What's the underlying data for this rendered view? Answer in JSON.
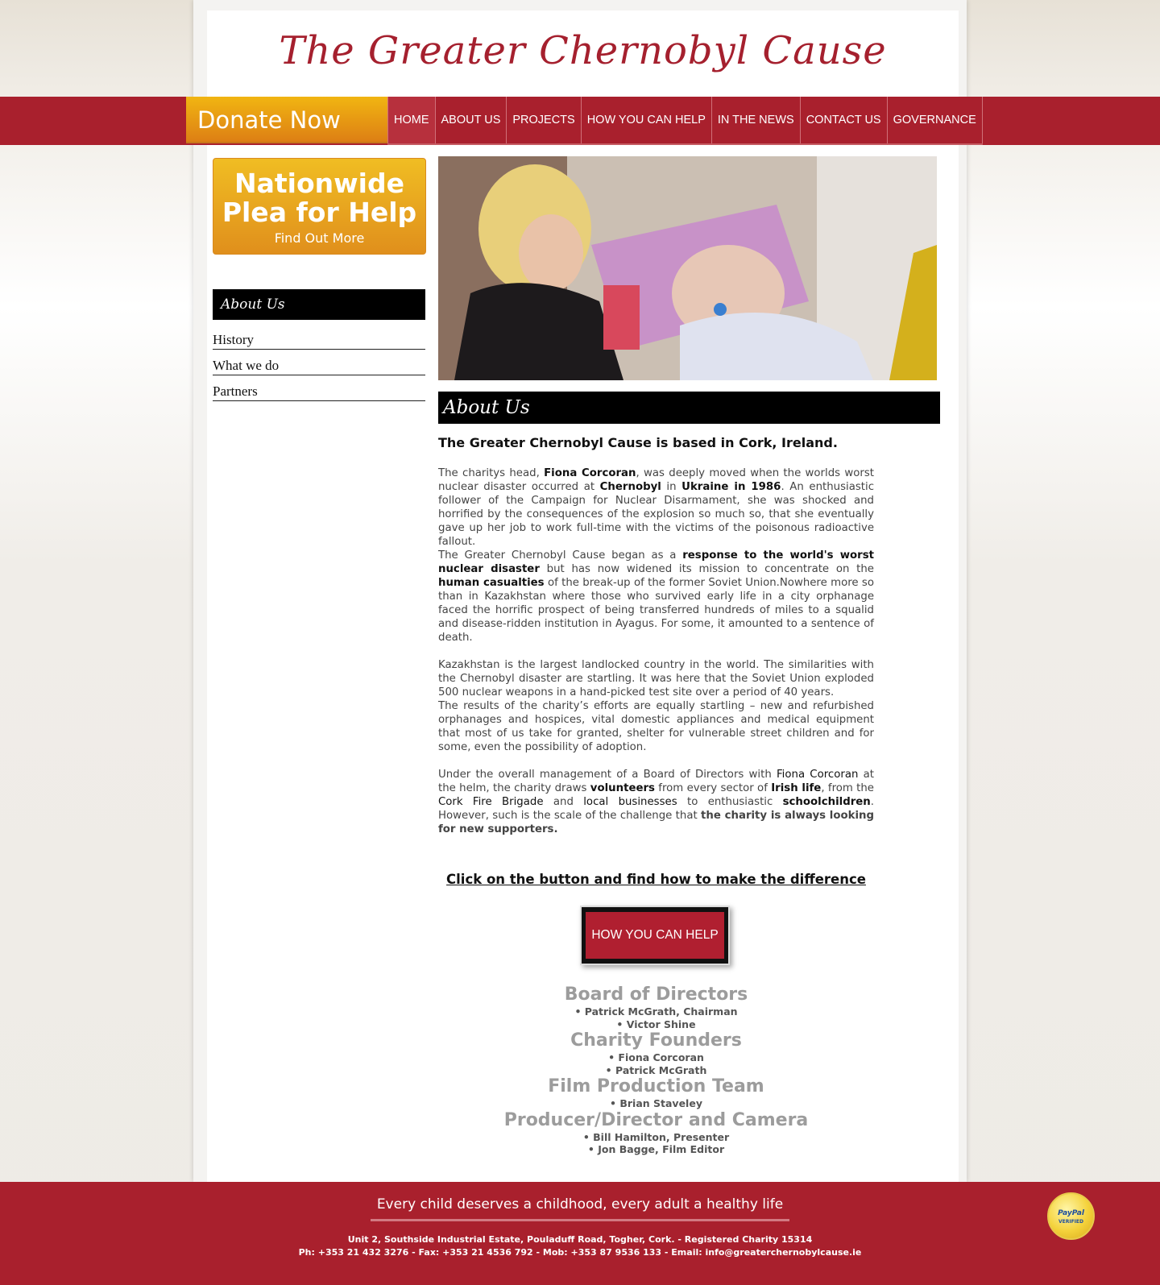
{
  "site": {
    "title": "The Greater Chernobyl Cause"
  },
  "donate": {
    "label": "Donate Now"
  },
  "nav": [
    {
      "label": "HOME"
    },
    {
      "label": "ABOUT US"
    },
    {
      "label": "PROJECTS"
    },
    {
      "label": "HOW YOU CAN HELP"
    },
    {
      "label": "IN THE NEWS"
    },
    {
      "label": "CONTACT US"
    },
    {
      "label": "GOVERNANCE"
    }
  ],
  "plea": {
    "title_line1": "Nationwide",
    "title_line2": "Plea for Help",
    "link": "Find Out More"
  },
  "sidebar": {
    "heading": "About Us",
    "items": [
      {
        "label": "History"
      },
      {
        "label": "What we do"
      },
      {
        "label": "Partners"
      }
    ]
  },
  "main": {
    "heading": "About Us",
    "lead": "The Greater Chernobyl Cause is based in Cork, Ireland.",
    "p1": {
      "t1": "The charitys head, ",
      "b1": "Fiona Corcoran",
      "t2": ", was deeply moved when the worlds worst nuclear disaster occurred at ",
      "b2": "Chernobyl",
      "t3": " in ",
      "b3": "Ukraine in 1986",
      "t4": ". An enthusiastic follower of the Campaign for Nuclear Disarmament, she was shocked and horrified by the consequences of the explosion so much so, that she eventually gave up her job to work full-time with the victims of the poisonous radioactive fallout."
    },
    "p2": {
      "t1": "The Greater Chernobyl Cause began as a ",
      "b1": "response to the world's worst nuclear disaster",
      "t2": " but has now widened its mission to concentrate on the ",
      "b2": "human casualties",
      "t3": " of the break-up of the former Soviet Union.Nowhere more so than in Kazakhstan where those who survived early life in a city orphanage faced the horrific prospect of being transferred hundreds of miles to a squalid and disease-ridden institution in Ayagus. For some, it amounted to a sentence of death."
    },
    "p3": "Kazakhstan is the largest landlocked country in the world. The similarities with the Chernobyl disaster are startling. It was here that the Soviet Union exploded 500 nuclear weapons in a hand-picked test site over a period of 40 years.",
    "p4": "The results of the charity’s efforts are equally startling – new and refurbished orphanages and hospices, vital domestic appliances and medical equipment that most of us take for granted, shelter for vulnerable street children and for some, even the possibility of adoption.",
    "p5": {
      "t1": "Under the overall management of a Board of Directors with ",
      "s1": "Fiona Corcoran",
      "t2": " at the helm, the charity draws ",
      "b1": "volunteers",
      "t3": " from every sector of ",
      "b2": "Irish life",
      "t4": ", from the ",
      "s2": "Cork Fire Brigade",
      "t5": " and ",
      "s3": "local businesses",
      "t6": " to enthusiastic ",
      "b3": "schoolchildren",
      "t7": ". However, such is the scale of the challenge that ",
      "b4": "the charity is always looking for new supporters."
    },
    "cta": "Click on the button and find how to make the difference",
    "help_button": "HOW YOU CAN HELP"
  },
  "team": [
    {
      "heading": "Board of Directors",
      "members": [
        "• Patrick McGrath, Chairman",
        "• Victor Shine"
      ]
    },
    {
      "heading": "Charity Founders",
      "members": [
        "• Fiona Corcoran",
        "• Patrick McGrath"
      ]
    },
    {
      "heading": "Film Production Team",
      "members": [
        "• Brian Staveley"
      ]
    },
    {
      "heading": "Producer/Director and Camera",
      "members": [
        "• Bill Hamilton, Presenter",
        "• Jon Bagge, Film Editor"
      ]
    }
  ],
  "footer": {
    "tagline": "Every child deserves a childhood, every adult a healthy life",
    "address": "Unit 2, Southside Industrial Estate, Pouladuff Road, Togher, Cork. - Registered Charity 15314",
    "contact": "Ph: +353 21 432 3276 - Fax: +353 21 4536 792 - Mob: +353 87 9536 133 - Email: info@greaterchernobylcause.ie",
    "badge": {
      "line1": "PayPal",
      "line2": "VERIFIED"
    }
  },
  "colors": {
    "brand_red": "#a9202d",
    "donate_orange": "#e08f1c",
    "text_gray": "#444444"
  }
}
